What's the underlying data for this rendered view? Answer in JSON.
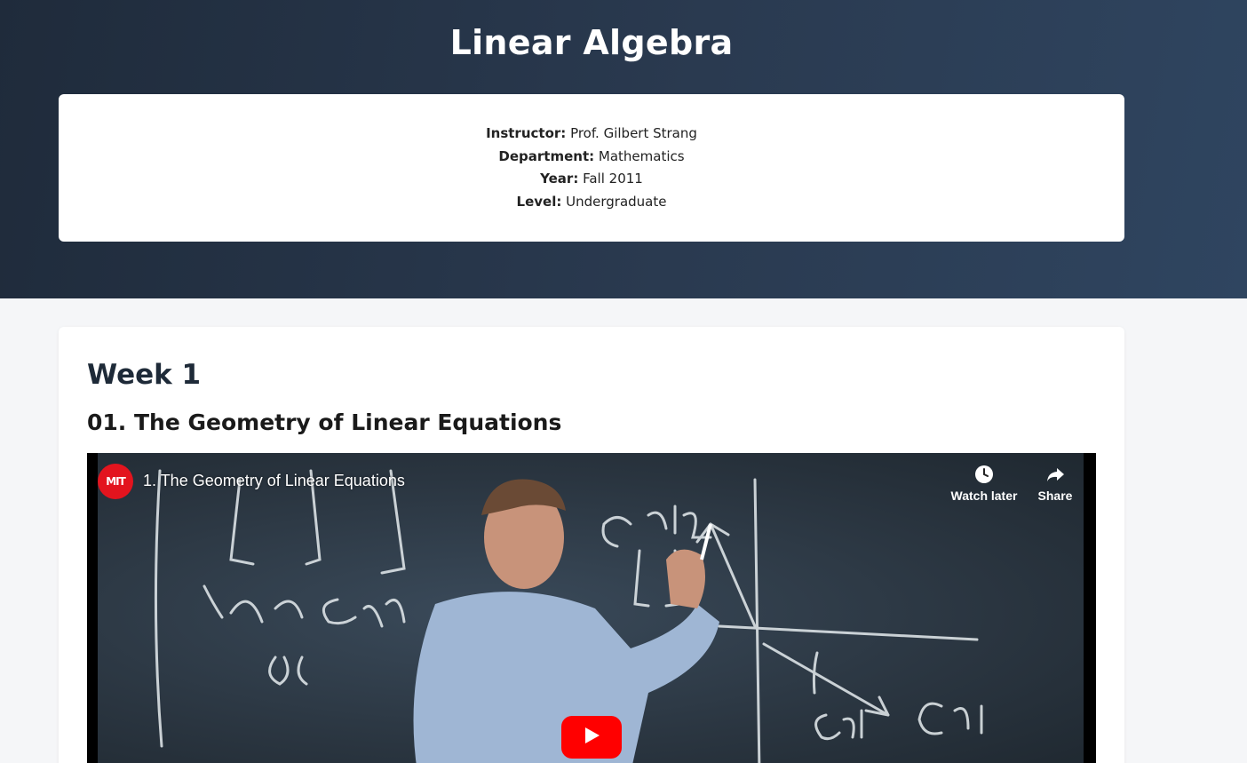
{
  "header": {
    "title": "Linear Algebra"
  },
  "course_info": {
    "instructor_label": "Instructor:",
    "instructor": "Prof. Gilbert Strang",
    "department_label": "Department:",
    "department": "Mathematics",
    "year_label": "Year:",
    "year": "Fall 2011",
    "level_label": "Level:",
    "level": "Undergraduate"
  },
  "content": {
    "week_title": "Week 1",
    "lecture_title": "01. The Geometry of Linear Equations",
    "video": {
      "channel_logo_text": "MIT",
      "title": "1. The Geometry of Linear Equations",
      "watch_later_label": "Watch later",
      "share_label": "Share"
    }
  },
  "colors": {
    "header_bg": "#2a3a50",
    "page_bg": "#f5f6f8",
    "play_button": "#ff0000",
    "channel_logo": "#e3141e"
  },
  "icons": [
    "clock-icon",
    "share-icon",
    "play-icon"
  ]
}
